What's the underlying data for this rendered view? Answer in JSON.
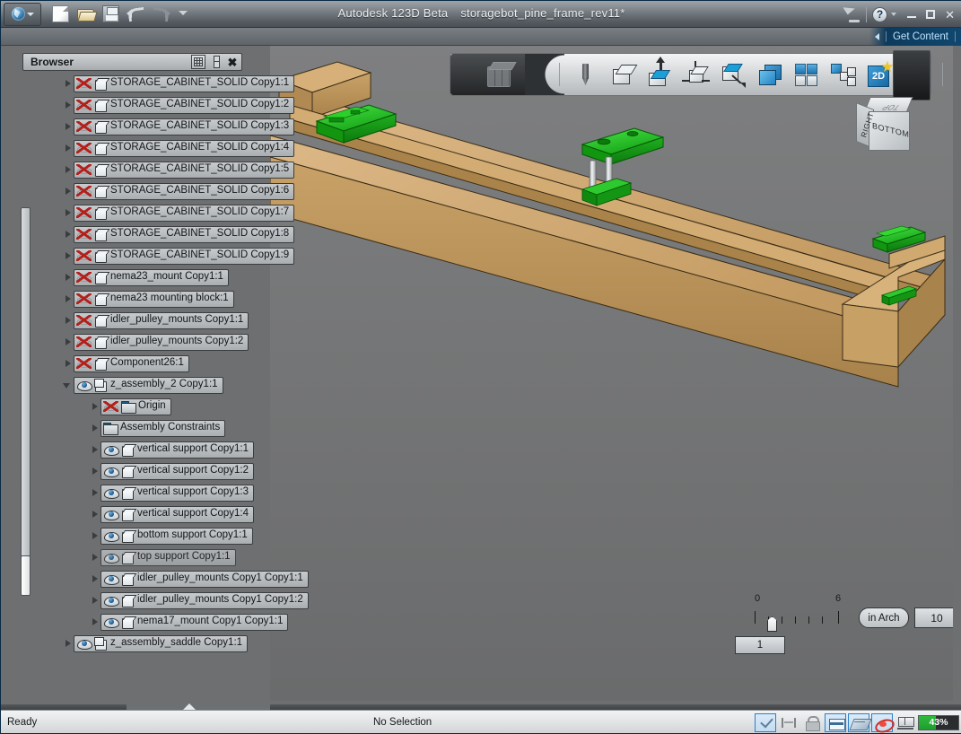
{
  "titlebar": {
    "app_name": "Autodesk 123D Beta",
    "document_name": "storagebot_pine_frame_rev11*",
    "quick_access": [
      {
        "name": "new-file-icon",
        "label": "New"
      },
      {
        "name": "open-file-icon",
        "label": "Open"
      },
      {
        "name": "save-file-icon",
        "label": "Save"
      },
      {
        "name": "undo-icon",
        "label": "Undo"
      },
      {
        "name": "redo-icon",
        "label": "Redo"
      },
      {
        "name": "customize-qat-icon",
        "label": "Customize Quick Access Toolbar"
      }
    ],
    "satellite_label": "Connect",
    "help_label": "?",
    "minimize_label": "Minimize",
    "maximize_label": "Maximize",
    "close_label": "✕"
  },
  "subbar": {
    "get_content_label": "Get Content",
    "separator": "|"
  },
  "browser": {
    "title": "Browser",
    "buttons": [
      {
        "name": "browser-filter-button",
        "label": "Filter"
      },
      {
        "name": "browser-dock-button",
        "label": "Dock"
      },
      {
        "name": "browser-close-button",
        "label": "✕"
      }
    ],
    "tree": [
      {
        "label": "STORAGE_CABINET_SOLID Copy1:1",
        "visible": false,
        "icon": "cube",
        "indent": 0,
        "expander": "collapsed"
      },
      {
        "label": "STORAGE_CABINET_SOLID Copy1:2",
        "visible": false,
        "icon": "cube",
        "indent": 0,
        "expander": "collapsed"
      },
      {
        "label": "STORAGE_CABINET_SOLID Copy1:3",
        "visible": false,
        "icon": "cube",
        "indent": 0,
        "expander": "collapsed"
      },
      {
        "label": "STORAGE_CABINET_SOLID Copy1:4",
        "visible": false,
        "icon": "cube",
        "indent": 0,
        "expander": "collapsed"
      },
      {
        "label": "STORAGE_CABINET_SOLID Copy1:5",
        "visible": false,
        "icon": "cube",
        "indent": 0,
        "expander": "collapsed"
      },
      {
        "label": "STORAGE_CABINET_SOLID Copy1:6",
        "visible": false,
        "icon": "cube",
        "indent": 0,
        "expander": "collapsed"
      },
      {
        "label": "STORAGE_CABINET_SOLID Copy1:7",
        "visible": false,
        "icon": "cube",
        "indent": 0,
        "expander": "collapsed"
      },
      {
        "label": "STORAGE_CABINET_SOLID Copy1:8",
        "visible": false,
        "icon": "cube",
        "indent": 0,
        "expander": "collapsed"
      },
      {
        "label": "STORAGE_CABINET_SOLID Copy1:9",
        "visible": false,
        "icon": "cube",
        "indent": 0,
        "expander": "collapsed"
      },
      {
        "label": "nema23_mount Copy1:1",
        "visible": false,
        "icon": "cube",
        "indent": 0,
        "expander": "collapsed"
      },
      {
        "label": "nema23 mounting block:1",
        "visible": false,
        "icon": "cube",
        "indent": 0,
        "expander": "collapsed"
      },
      {
        "label": "idler_pulley_mounts Copy1:1",
        "visible": false,
        "icon": "cube",
        "indent": 0,
        "expander": "collapsed"
      },
      {
        "label": "idler_pulley_mounts Copy1:2",
        "visible": false,
        "icon": "cube",
        "indent": 0,
        "expander": "collapsed"
      },
      {
        "label": "Component26:1",
        "visible": false,
        "icon": "cube",
        "indent": 0,
        "expander": "collapsed"
      },
      {
        "label": "z_assembly_2 Copy1:1",
        "visible": true,
        "icon": "assembly",
        "indent": 0,
        "expander": "expanded"
      },
      {
        "label": "Origin",
        "visible": false,
        "icon": "folder",
        "indent": 1,
        "expander": "collapsed"
      },
      {
        "label": "Assembly Constraints",
        "visible": null,
        "icon": "folder",
        "indent": 1,
        "expander": "collapsed"
      },
      {
        "label": "vertical support Copy1:1",
        "visible": true,
        "icon": "cube",
        "indent": 1,
        "expander": "collapsed"
      },
      {
        "label": "vertical support Copy1:2",
        "visible": true,
        "icon": "cube",
        "indent": 1,
        "expander": "collapsed"
      },
      {
        "label": "vertical support Copy1:3",
        "visible": true,
        "icon": "cube",
        "indent": 1,
        "expander": "collapsed"
      },
      {
        "label": "vertical support Copy1:4",
        "visible": true,
        "icon": "cube",
        "indent": 1,
        "expander": "collapsed"
      },
      {
        "label": "bottom support Copy1:1",
        "visible": true,
        "icon": "cube",
        "indent": 1,
        "expander": "collapsed"
      },
      {
        "label": "top support Copy1:1",
        "visible": true,
        "icon": "cube",
        "indent": 1,
        "expander": "collapsed",
        "dim": true
      },
      {
        "label": "idler_pulley_mounts Copy1 Copy1:1",
        "visible": true,
        "icon": "cube",
        "indent": 1,
        "expander": "collapsed"
      },
      {
        "label": "idler_pulley_mounts Copy1 Copy1:2",
        "visible": true,
        "icon": "cube",
        "indent": 1,
        "expander": "collapsed"
      },
      {
        "label": "nema17_mount Copy1 Copy1:1",
        "visible": true,
        "icon": "cube",
        "indent": 1,
        "expander": "collapsed"
      },
      {
        "label": "z_assembly_saddle Copy1:1",
        "visible": true,
        "icon": "assembly",
        "indent": 0,
        "expander": "collapsed"
      }
    ]
  },
  "navbar": {
    "tools": [
      {
        "name": "navcube-home-icon",
        "label": "View Cube"
      },
      {
        "name": "sketch-pen-icon",
        "label": "Sketch"
      },
      {
        "name": "primitive-cube-icon",
        "label": "Primitives"
      },
      {
        "name": "extrude-icon",
        "label": "Construct"
      },
      {
        "name": "move-icon",
        "label": "Modify"
      },
      {
        "name": "press-pull-icon",
        "label": "Pattern"
      },
      {
        "name": "layers-icon",
        "label": "Combine"
      },
      {
        "name": "grid-four-icon",
        "label": "Grid"
      },
      {
        "name": "combine-blocks-icon",
        "label": "Assemble"
      },
      {
        "name": "create-2d-icon",
        "label": "2D"
      },
      {
        "name": "magic-wand-icon",
        "label": "Smart Tools"
      }
    ]
  },
  "viewcube": {
    "face_right": "RIGHT",
    "face_bottom": "BOTTOM",
    "face_top": "TOP"
  },
  "scale_widget": {
    "tick_min": "0",
    "tick_max": "6",
    "tick_count": 7,
    "unit_button": "in Arch",
    "quantity_value": "10",
    "scale_value": "1"
  },
  "statusbar": {
    "ready_text": "Ready",
    "selection_text": "No Selection",
    "icons": [
      {
        "name": "check-valid-icon",
        "label": "Valid",
        "active": true
      },
      {
        "name": "constraint-icon",
        "label": "Constraints",
        "active": false
      },
      {
        "name": "lock-icon",
        "label": "Lock",
        "active": false
      },
      {
        "name": "snap-grid-icon",
        "label": "Snap",
        "active": true
      },
      {
        "name": "workplane-icon",
        "label": "Work Plane",
        "active": true
      },
      {
        "name": "orbit-icon",
        "label": "Orbit",
        "active": true
      },
      {
        "name": "display-mode-icon",
        "label": "Display",
        "active": false
      }
    ],
    "progress_percent": "43%",
    "progress_value": 43,
    "progress_color": "#1f9e2e"
  },
  "colors": {
    "accent_blue": "#1868a2",
    "wood": "#c9a065",
    "wood_light": "#d9b580",
    "wood_dark": "#9a7742",
    "part_green": "#2fc22f",
    "viewport_bg": "#6e6f70"
  }
}
